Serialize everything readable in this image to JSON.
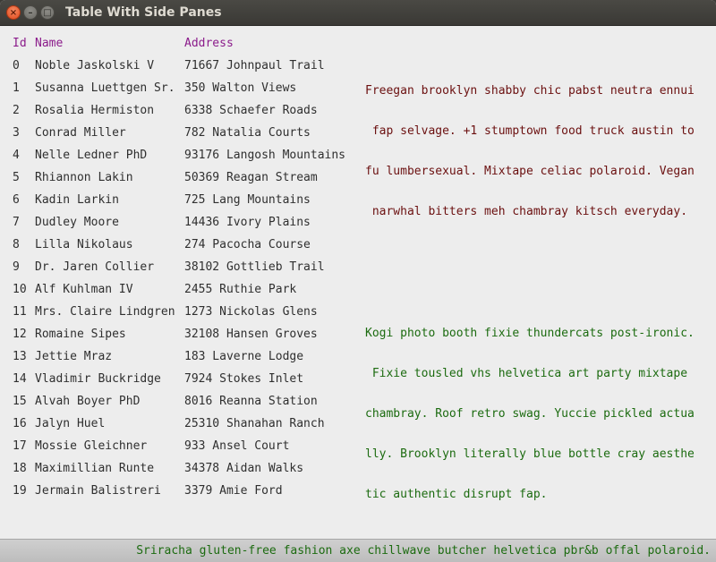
{
  "window": {
    "title": "Table With Side Panes",
    "close_glyph": "×",
    "minimize_glyph": "–",
    "maximize_glyph": "□"
  },
  "table": {
    "headers": {
      "id": "Id",
      "name": "Name",
      "address": "Address"
    },
    "rows": [
      {
        "id": "0",
        "name": "Noble Jaskolski V",
        "address": "71667 Johnpaul Trail"
      },
      {
        "id": "1",
        "name": "Susanna Luettgen Sr.",
        "address": "350 Walton Views"
      },
      {
        "id": "2",
        "name": "Rosalia Hermiston",
        "address": "6338 Schaefer Roads"
      },
      {
        "id": "3",
        "name": "Conrad Miller",
        "address": "782 Natalia Courts"
      },
      {
        "id": "4",
        "name": "Nelle Ledner PhD",
        "address": "93176 Langosh Mountains"
      },
      {
        "id": "5",
        "name": "Rhiannon Lakin",
        "address": "50369 Reagan Stream"
      },
      {
        "id": "6",
        "name": "Kadin Larkin",
        "address": "725 Lang Mountains"
      },
      {
        "id": "7",
        "name": "Dudley Moore",
        "address": "14436 Ivory Plains"
      },
      {
        "id": "8",
        "name": "Lilla Nikolaus",
        "address": "274 Pacocha Course"
      },
      {
        "id": "9",
        "name": "Dr. Jaren Collier",
        "address": "38102 Gottlieb Trail"
      },
      {
        "id": "10",
        "name": "Alf Kuhlman IV",
        "address": "2455 Ruthie Park"
      },
      {
        "id": "11",
        "name": "Mrs. Claire Lindgren",
        "address": "1273 Nickolas Glens"
      },
      {
        "id": "12",
        "name": "Romaine Sipes",
        "address": "32108 Hansen Groves"
      },
      {
        "id": "13",
        "name": "Jettie Mraz",
        "address": "183 Laverne Lodge"
      },
      {
        "id": "14",
        "name": "Vladimir Buckridge",
        "address": "7924 Stokes Inlet"
      },
      {
        "id": "15",
        "name": "Alvah Boyer PhD",
        "address": "8016 Reanna Station"
      },
      {
        "id": "16",
        "name": "Jalyn Huel",
        "address": "25310 Shanahan Ranch"
      },
      {
        "id": "17",
        "name": "Mossie Gleichner",
        "address": "933 Ansel Court"
      },
      {
        "id": "18",
        "name": "Maximillian Runte",
        "address": "34378 Aidan Walks"
      },
      {
        "id": "19",
        "name": "Jermain Balistreri",
        "address": "3379 Amie Ford"
      }
    ]
  },
  "side_panes": {
    "top": {
      "color": "#6b1010",
      "lines": [
        "Freegan brooklyn shabby chic pabst neutra ennui",
        " fap selvage. +1 stumptown food truck austin to",
        "fu lumbersexual. Mixtape celiac polaroid. Vegan",
        " narwhal bitters meh chambray kitsch everyday."
      ]
    },
    "middle": {
      "color": "#1c6b10",
      "lines": [
        "Kogi photo booth fixie thundercats post-ironic.",
        " Fixie tousled vhs helvetica art party mixtape",
        "chambray. Roof retro swag. Yuccie pickled actua",
        "lly. Brooklyn literally blue bottle cray aesthe",
        "tic authentic disrupt fap."
      ]
    }
  },
  "status_bar": {
    "text": "Sriracha gluten-free fashion axe chillwave butcher helvetica pbr&b offal polaroid.",
    "color": "#1c6b10"
  },
  "colors": {
    "header_text": "#8b1c8b",
    "body_text": "#2f2f2f",
    "background": "#ededed",
    "titlebar": "#3c3b37",
    "close_button": "#e0491c"
  }
}
